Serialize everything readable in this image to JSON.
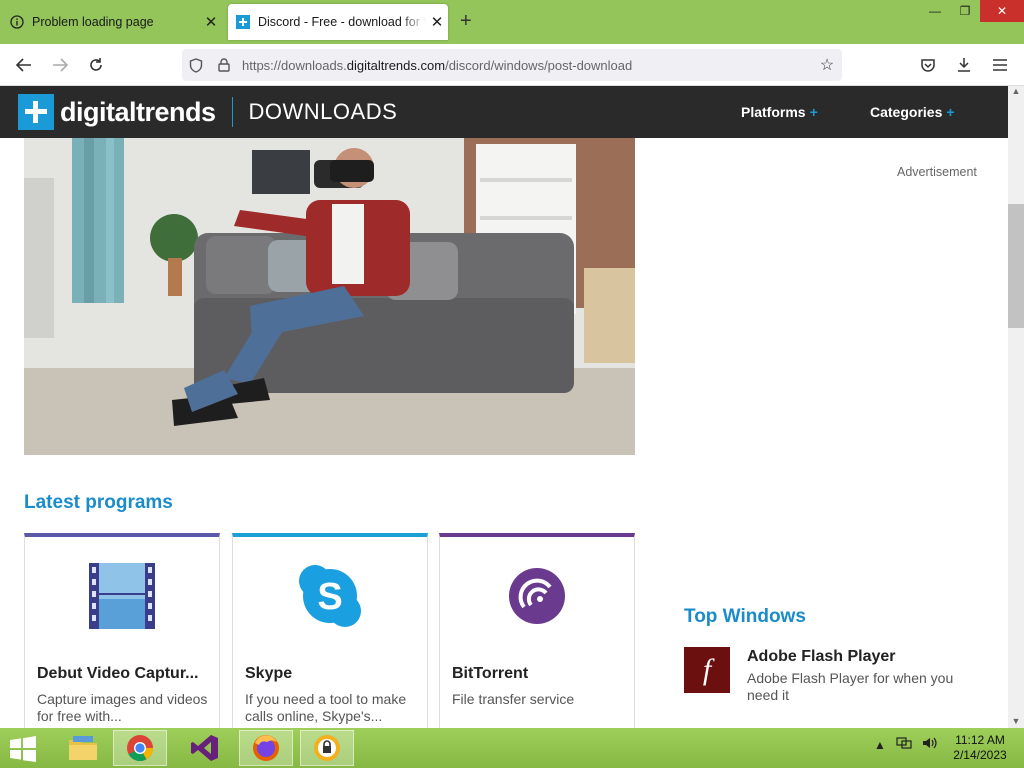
{
  "browser": {
    "tabs": [
      {
        "label": "Problem loading page",
        "icon": "info-icon"
      },
      {
        "label": "Discord - Free - download for Windows",
        "icon": "digitaltrends-favicon"
      }
    ],
    "new_tab_label": "+",
    "url_prefix": "https://downloads.",
    "url_domain": "digitaltrends.com",
    "url_path": "/discord/windows/post-download"
  },
  "site": {
    "brand": "digitaltrends",
    "brand_suffix": "DOWNLOADS",
    "menu": [
      {
        "label": "Platforms",
        "plus": "+"
      },
      {
        "label": "Categories",
        "plus": "+"
      }
    ],
    "advertisement": "Advertisement"
  },
  "latest": {
    "title": "Latest programs",
    "cards": [
      {
        "name": "Debut Video Captur...",
        "desc": "Capture images and videos for free with...",
        "accent": "#5a5aa8"
      },
      {
        "name": "Skype",
        "desc": "If you need a tool to make calls online, Skype's...",
        "accent": "#1aa0d6"
      },
      {
        "name": "BitTorrent",
        "desc": "File transfer service",
        "accent": "#6a3a8e"
      }
    ]
  },
  "top_windows": {
    "title": "Top Windows",
    "items": [
      {
        "name": "Adobe Flash Player",
        "desc": "Adobe Flash Player for when you need it",
        "icon_glyph": "f"
      }
    ]
  },
  "taskbar": {
    "time": "11:12 AM",
    "date": "2/14/2023"
  },
  "colors": {
    "accent_blue": "#1a8cc9",
    "header_dark": "#2a2a2a",
    "tab_bar_green": "#93c55a"
  }
}
